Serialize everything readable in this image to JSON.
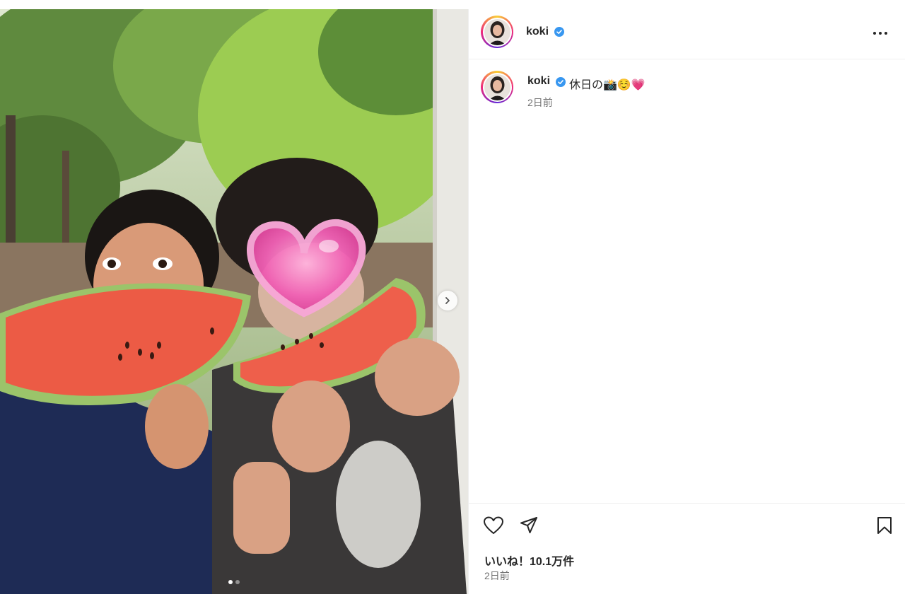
{
  "post": {
    "username": "koki",
    "caption": "休日の📸☺️💗",
    "caption_time": "2日前",
    "likes": "いいね！10.1万件",
    "footer_time": "2日前",
    "carousel": {
      "total": 2,
      "current": 1
    }
  },
  "icons": {
    "verified": "verified-badge-icon",
    "more": "more-options-icon",
    "like": "heart-outline-icon",
    "share": "paper-plane-icon",
    "save": "bookmark-icon",
    "next": "chevron-right-icon"
  },
  "colors": {
    "verified_blue": "#3897f0",
    "text_primary": "#262626",
    "text_secondary": "#737373",
    "divider": "#efefef"
  }
}
